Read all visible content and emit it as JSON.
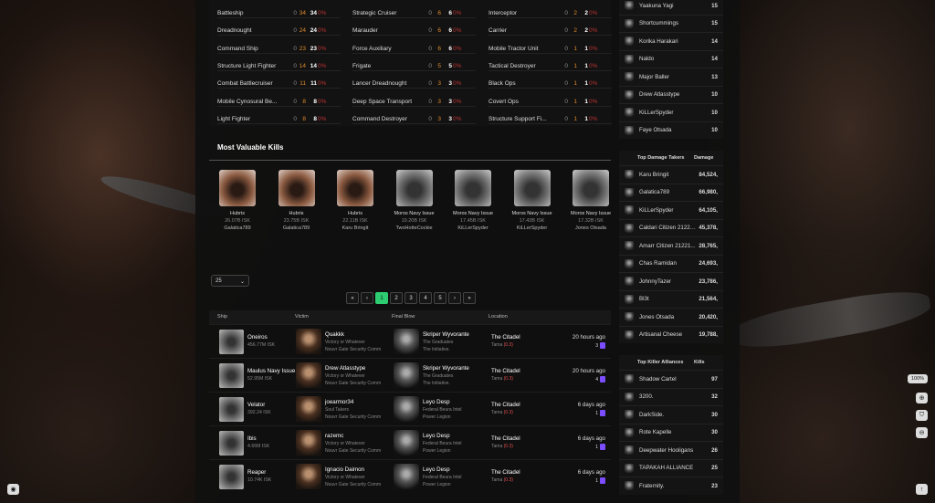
{
  "class_table": {
    "col1": [
      {
        "name": "Battleship",
        "a": "0",
        "b": "34",
        "c": "34",
        "p": "0%"
      },
      {
        "name": "Dreadnought",
        "a": "0",
        "b": "24",
        "c": "24",
        "p": "0%"
      },
      {
        "name": "Command Ship",
        "a": "0",
        "b": "23",
        "c": "23",
        "p": "0%"
      },
      {
        "name": "Structure Light Fighter",
        "a": "0",
        "b": "14",
        "c": "14",
        "p": "0%"
      },
      {
        "name": "Combat Battlecruiser",
        "a": "0",
        "b": "11",
        "c": "11",
        "p": "0%"
      },
      {
        "name": "Mobile Cynosural Be...",
        "a": "0",
        "b": "8",
        "c": "8",
        "p": "0%"
      },
      {
        "name": "Light Fighter",
        "a": "0",
        "b": "8",
        "c": "8",
        "p": "0%"
      }
    ],
    "col2": [
      {
        "name": "Strategic Cruiser",
        "a": "0",
        "b": "6",
        "c": "6",
        "p": "0%"
      },
      {
        "name": "Marauder",
        "a": "0",
        "b": "6",
        "c": "6",
        "p": "0%"
      },
      {
        "name": "Force Auxiliary",
        "a": "0",
        "b": "6",
        "c": "6",
        "p": "0%"
      },
      {
        "name": "Frigate",
        "a": "0",
        "b": "5",
        "c": "5",
        "p": "0%"
      },
      {
        "name": "Lancer Dreadnought",
        "a": "0",
        "b": "3",
        "c": "3",
        "p": "0%"
      },
      {
        "name": "Deep Space Transport",
        "a": "0",
        "b": "3",
        "c": "3",
        "p": "0%"
      },
      {
        "name": "Command Destroyer",
        "a": "0",
        "b": "3",
        "c": "3",
        "p": "0%"
      }
    ],
    "col3": [
      {
        "name": "Interceptor",
        "a": "0",
        "b": "2",
        "c": "2",
        "p": "0%"
      },
      {
        "name": "Carrier",
        "a": "0",
        "b": "2",
        "c": "2",
        "p": "0%"
      },
      {
        "name": "Mobile Tractor Unit",
        "a": "0",
        "b": "1",
        "c": "1",
        "p": "0%"
      },
      {
        "name": "Tactical Destroyer",
        "a": "0",
        "b": "1",
        "c": "1",
        "p": "0%"
      },
      {
        "name": "Black Ops",
        "a": "0",
        "b": "1",
        "c": "1",
        "p": "0%"
      },
      {
        "name": "Covert Ops",
        "a": "0",
        "b": "1",
        "c": "1",
        "p": "0%"
      },
      {
        "name": "Structure Support Fi...",
        "a": "0",
        "b": "1",
        "c": "1",
        "p": "0%"
      }
    ]
  },
  "mvk": {
    "title": "Most Valuable Kills",
    "items": [
      {
        "ship": "Hubris",
        "isk": "26.07B ISK",
        "char": "Galatica789",
        "type": "hub"
      },
      {
        "ship": "Hubris",
        "isk": "23.75B ISK",
        "char": "Galatica789",
        "type": "hub"
      },
      {
        "ship": "Hubris",
        "isk": "22.11B ISK",
        "char": "Karu Bringit",
        "type": "hub"
      },
      {
        "ship": "Moros Navy Issue",
        "isk": "19.20B ISK",
        "char": "TwoHotteCockie",
        "type": "mor"
      },
      {
        "ship": "Moros Navy Issue",
        "isk": "17.45B ISK",
        "char": "KiLLerSpyder",
        "type": "mor"
      },
      {
        "ship": "Moros Navy Issue",
        "isk": "17.43B ISK",
        "char": "KiLLerSpyder",
        "type": "mor"
      },
      {
        "ship": "Moros Navy Issue",
        "isk": "17.32B ISK",
        "char": "Jones Otsada",
        "type": "mor"
      }
    ]
  },
  "per_page": "25",
  "pagination": [
    "«",
    "‹",
    "1",
    "2",
    "3",
    "4",
    "5",
    "›",
    "»"
  ],
  "killlist": {
    "headers": {
      "ship": "Ship",
      "victim": "Victim",
      "final": "Final Blow",
      "location": "Location"
    },
    "rows": [
      {
        "ship": "Oneiros",
        "isk": "456.77M ISK",
        "victim": "Quakkk",
        "vcorp": "Victory or Whatever",
        "valliance": "Nouvr Gate Security Comm",
        "final": "Skriper Wyvorante",
        "fcorp": "The Graduates",
        "falliance": "The Initiative.",
        "loc": "The Citadel",
        "region": "Tama",
        "sec": "(0.3)",
        "time": "20 hours ago",
        "count": "3"
      },
      {
        "ship": "Maulus Navy Issue",
        "isk": "52.95M ISK",
        "victim": "Drew Atlasstype",
        "vcorp": "Victory or Whatever",
        "valliance": "Nouvr Gate Security Comm",
        "final": "Skriper Wyvorante",
        "fcorp": "The Graduates",
        "falliance": "The Initiative.",
        "loc": "The Citadel",
        "region": "Tama",
        "sec": "(0.3)",
        "time": "20 hours ago",
        "count": "4"
      },
      {
        "ship": "Velator",
        "isk": "392.24 ISK",
        "victim": "joearmor34",
        "vcorp": "Soul Takers",
        "valliance": "Nouvr Gate Security Comm",
        "final": "Leyo Desp",
        "fcorp": "Federal Beura Intel",
        "falliance": "Power Legion",
        "loc": "The Citadel",
        "region": "Tama",
        "sec": "(0.3)",
        "time": "6 days ago",
        "count": "1"
      },
      {
        "ship": "Ibis",
        "isk": "4.66M ISK",
        "victim": "razemc",
        "vcorp": "Victory or Whatever",
        "valliance": "Nouvr Gate Security Comm",
        "final": "Leyo Desp",
        "fcorp": "Federal Beura Intel",
        "falliance": "Power Legion",
        "loc": "The Citadel",
        "region": "Tama",
        "sec": "(0.3)",
        "time": "6 days ago",
        "count": "1"
      },
      {
        "ship": "Reaper",
        "isk": "10.74K ISK",
        "victim": "Ignacio Daimon",
        "vcorp": "Victory or Whatever",
        "valliance": "Nouvr Gate Security Comm",
        "final": "Leyo Desp",
        "fcorp": "Federal Beura Intel",
        "falliance": "Power Legion",
        "loc": "The Citadel",
        "region": "Tama",
        "sec": "(0.3)",
        "time": "6 days ago",
        "count": "1"
      }
    ]
  },
  "sidebar": {
    "top_list": [
      {
        "name": "Yaakuna Yagi",
        "val": "15"
      },
      {
        "name": "Shortcummings",
        "val": "15"
      },
      {
        "name": "Korika Harakari",
        "val": "14"
      },
      {
        "name": "Naldo",
        "val": "14"
      },
      {
        "name": "Major Baller",
        "val": "13"
      },
      {
        "name": "Drew Atlasstype",
        "val": "10"
      },
      {
        "name": "KiLLerSpyder",
        "val": "10"
      },
      {
        "name": "Faye Otsada",
        "val": "10"
      }
    ],
    "damage_title": "Top Damage Takers",
    "damage_col": "Damage",
    "damage": [
      {
        "name": "Karu Bringit",
        "val": "84,524,"
      },
      {
        "name": "Galatica789",
        "val": "66,980,"
      },
      {
        "name": "KiLLerSpyder",
        "val": "64,105,"
      },
      {
        "name": "Caldari Citizen 21220...",
        "val": "45,378,"
      },
      {
        "name": "Amarr Citizen 21221...",
        "val": "28,765,"
      },
      {
        "name": "Chas Ramidan",
        "val": "24,693,"
      },
      {
        "name": "JohnnyTazer",
        "val": "23,786,"
      },
      {
        "name": "Bl3t",
        "val": "21,564,"
      },
      {
        "name": "Jones Otsada",
        "val": "20,420,"
      },
      {
        "name": "Artisanal Cheese",
        "val": "19,788,"
      }
    ],
    "alliance_title": "Top Killer Alliances",
    "alliance_col": "Kills",
    "alliances": [
      {
        "name": "Shadow Cartel",
        "val": "97"
      },
      {
        "name": "3200.",
        "val": "32"
      },
      {
        "name": "DarkSide.",
        "val": "30"
      },
      {
        "name": "Rote Kapelle",
        "val": "30"
      },
      {
        "name": "Deepwater Hooligans",
        "val": "26"
      },
      {
        "name": "TAPAKAH ALLIANCE",
        "val": "25"
      },
      {
        "name": "Fraternity.",
        "val": "23"
      }
    ]
  },
  "zoom": "100%",
  "colors": {
    "accent": "#2ecc71",
    "orange": "#e08a2c",
    "purple": "#7c4dff",
    "sec": "#e05050"
  }
}
